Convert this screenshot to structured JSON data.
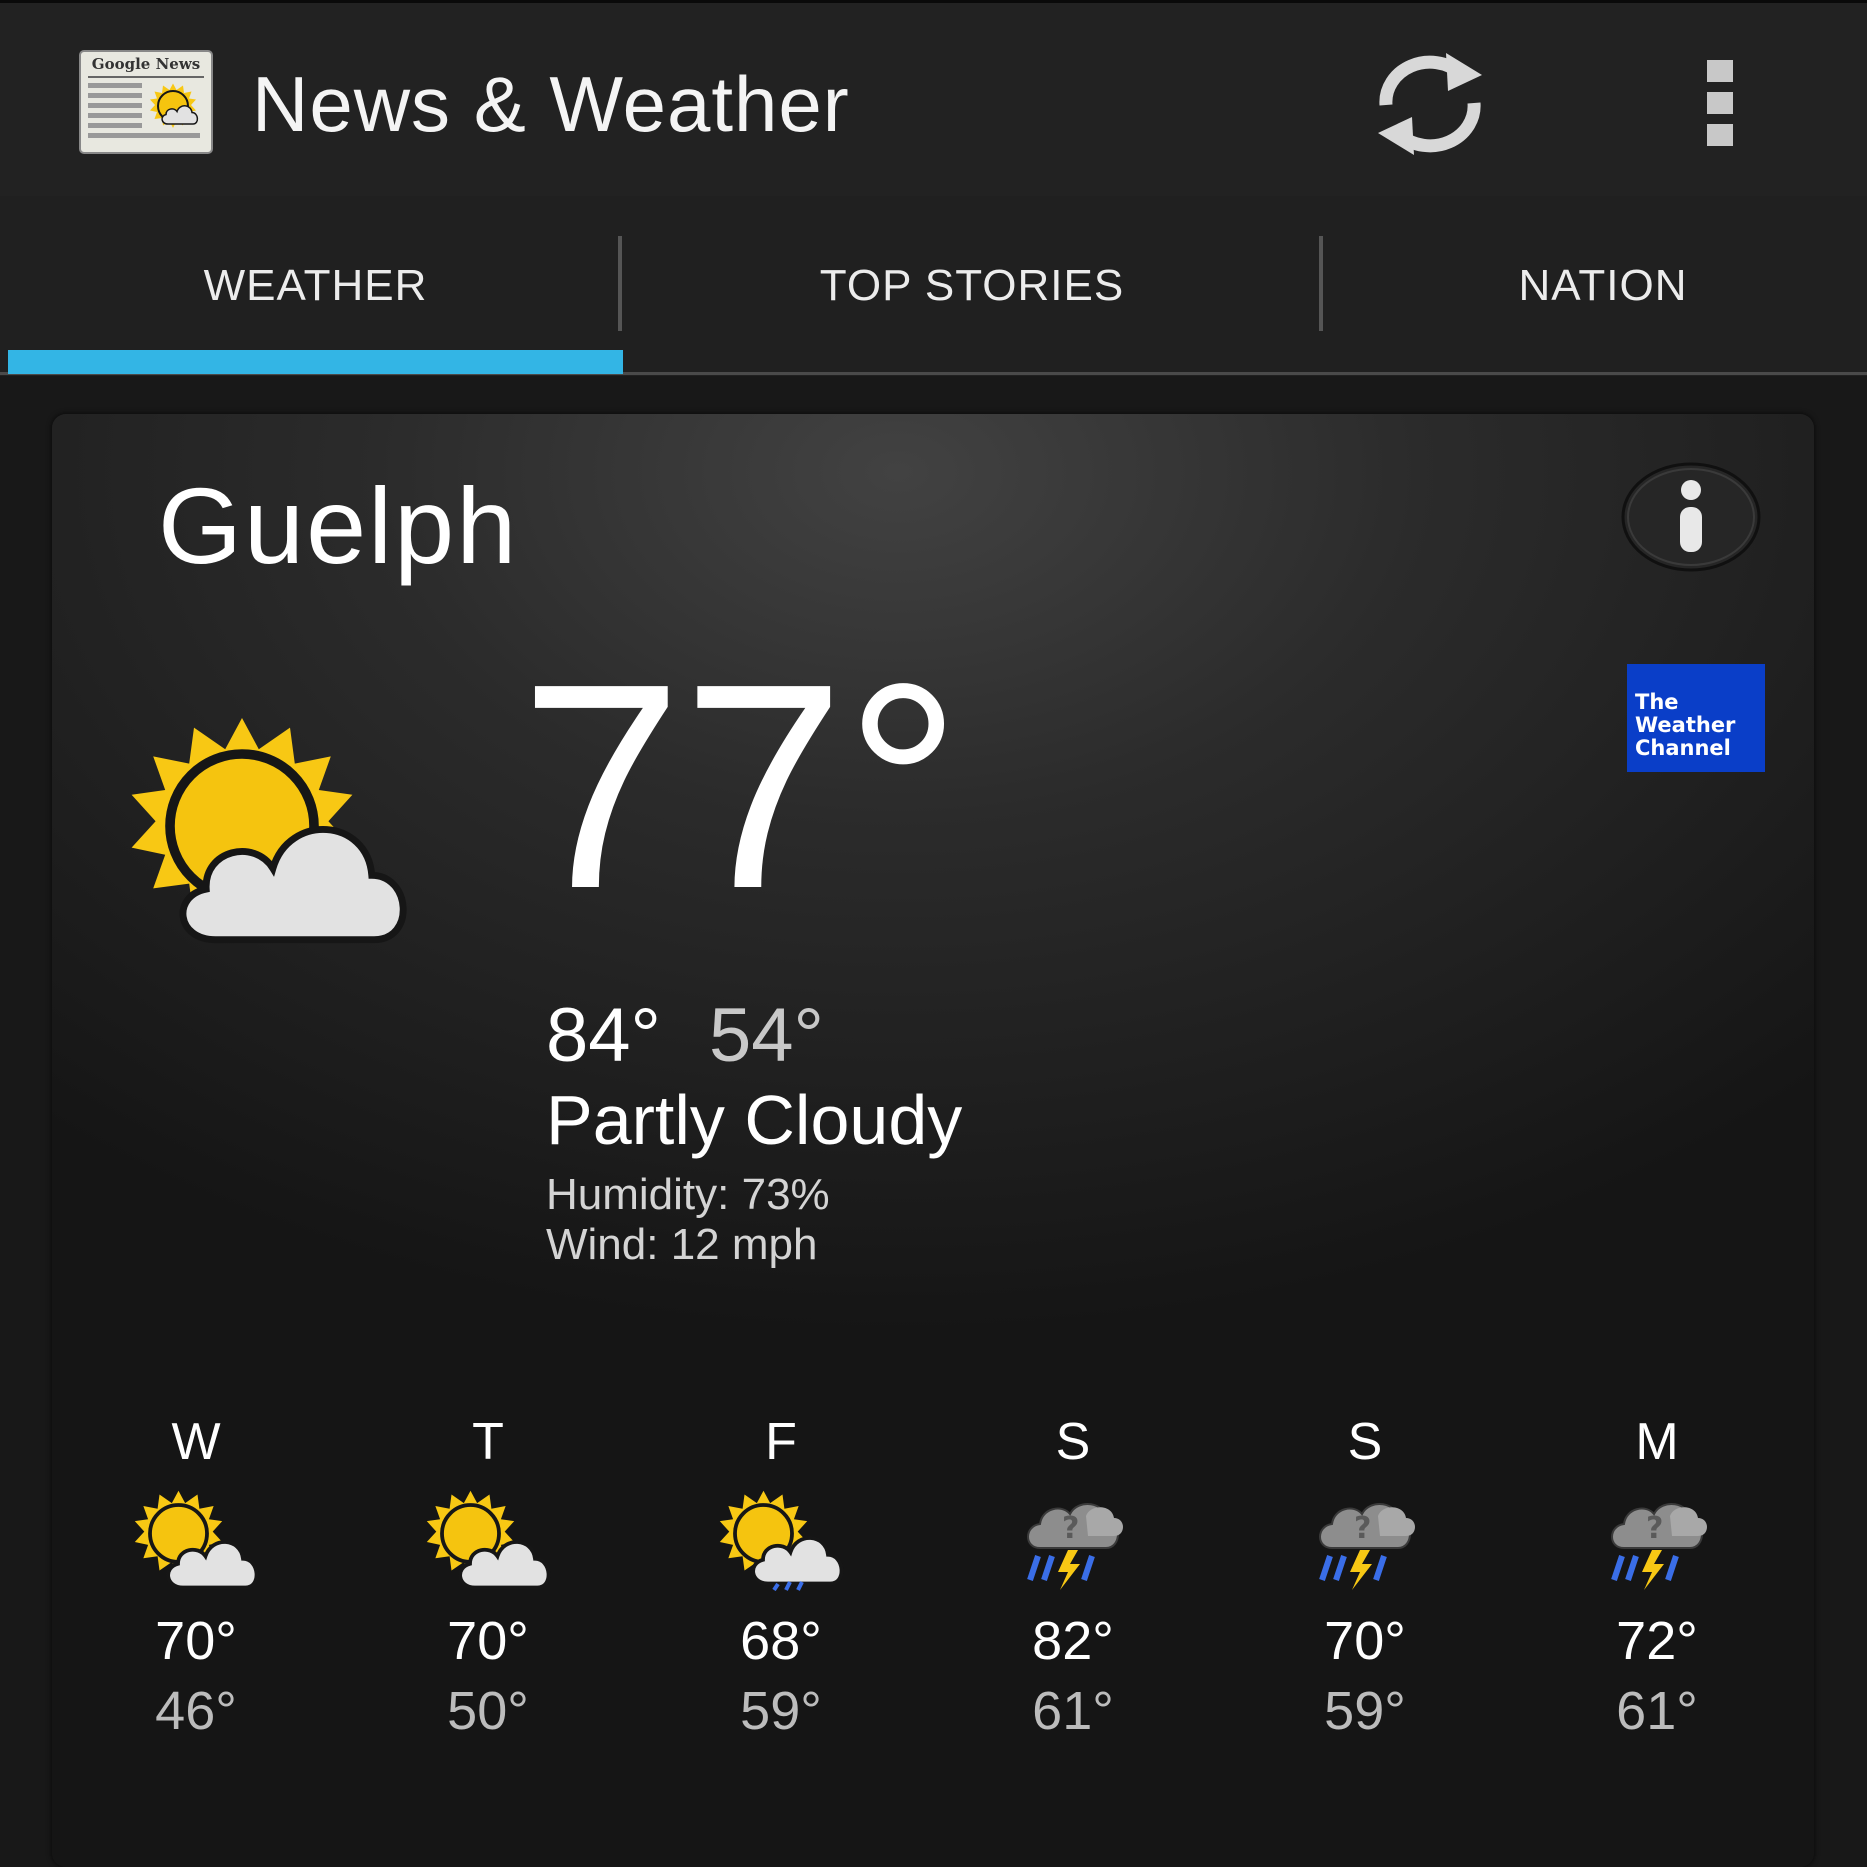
{
  "app": {
    "title": "News & Weather",
    "icon_text": "Google News"
  },
  "tabs": [
    {
      "label": "WEATHER",
      "selected": true
    },
    {
      "label": "TOP STORIES",
      "selected": false
    },
    {
      "label": "NATION",
      "selected": false
    }
  ],
  "colors": {
    "accent": "#33b5e5",
    "sun": "#f8c814",
    "rain": "#3a6ee8",
    "twc_blue": "#0a3ec8"
  },
  "weather": {
    "city": "Guelph",
    "provider_logo": [
      "The",
      "Weather",
      "Channel"
    ],
    "current_temp": "77°",
    "high": "84°",
    "low": "54°",
    "condition": "Partly Cloudy",
    "humidity": "Humidity: 73%",
    "wind": "Wind: 12 mph",
    "condition_icon": "partly-cloudy-icon",
    "forecast": [
      {
        "day": "W",
        "high": "70°",
        "low": "46°",
        "icon": "partly-cloudy-icon"
      },
      {
        "day": "T",
        "high": "70°",
        "low": "50°",
        "icon": "partly-cloudy-icon"
      },
      {
        "day": "F",
        "high": "68°",
        "low": "59°",
        "icon": "chance-of-rain-icon"
      },
      {
        "day": "S",
        "high": "82°",
        "low": "61°",
        "icon": "chance-of-storm-icon"
      },
      {
        "day": "S",
        "high": "70°",
        "low": "59°",
        "icon": "chance-of-storm-icon"
      },
      {
        "day": "M",
        "high": "72°",
        "low": "61°",
        "icon": "chance-of-storm-icon"
      }
    ]
  }
}
